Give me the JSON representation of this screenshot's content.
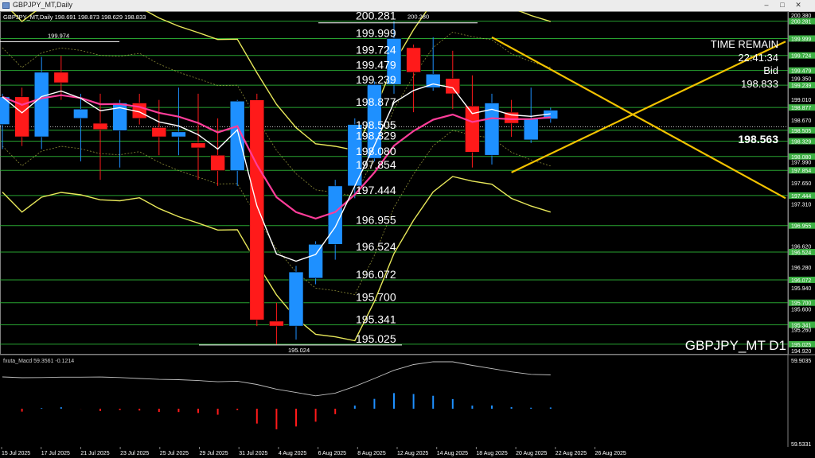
{
  "window": {
    "title": "GBPJPY_MT,Daily",
    "minimize_glyph": "–",
    "maximize_glyph": "□",
    "close_glyph": "✕"
  },
  "header": {
    "ohlc_text": "GBPJPY_MT,Daily  198.691 198.873 198.629 198.833"
  },
  "info": {
    "time_label": "TIME REMAIN",
    "time_value": "22:41:34",
    "bid_label": "Bid",
    "bid_value": "198.833",
    "current_price": "198.563",
    "symbol_label": "GBPJPY_MT D1"
  },
  "chart_data": [
    {
      "type": "candlestick",
      "title": "GBPJPY_MT,Daily",
      "ylim": [
        194.92,
        200.38
      ],
      "x_labels": [
        "15 Jul 2025",
        "17 Jul 2025",
        "21 Jul 2025",
        "23 Jul 2025",
        "25 Jul 2025",
        "29 Jul 2025",
        "31 Jul 2025",
        "4 Aug 2025",
        "6 Aug 2025",
        "8 Aug 2025",
        "12 Aug 2025",
        "14 Aug 2025",
        "18 Aug 2025",
        "20 Aug 2025",
        "22 Aug 2025",
        "26 Aug 2025"
      ],
      "axis_ticks": [
        "200.380",
        "200.281",
        "199.999",
        "199.724",
        "199.479",
        "199.350",
        "199.239",
        "199.010",
        "198.877",
        "198.670",
        "198.505",
        "198.329",
        "198.080",
        "197.990",
        "197.854",
        "197.650",
        "197.444",
        "197.310",
        "196.955",
        "196.620",
        "196.524",
        "196.280",
        "196.072",
        "195.940",
        "195.700",
        "195.600",
        "195.341",
        "195.260",
        "195.025",
        "194.920"
      ],
      "level_labels": [
        "200.281",
        "199.999",
        "199.724",
        "199.479",
        "199.239",
        "198.877",
        "198.505",
        "198.329",
        "198.080",
        "197.854",
        "197.444",
        "196.955",
        "196.524",
        "196.072",
        "195.700",
        "195.341",
        "195.025"
      ],
      "extreme_labels": [
        {
          "text": "199.974",
          "price": 199.974
        },
        {
          "text": "200.280",
          "price": 200.28
        },
        {
          "text": "195.024",
          "price": 195.024
        }
      ],
      "candles": [
        {
          "o": 198.6,
          "h": 199.1,
          "l": 198.2,
          "c": 199.05
        },
        {
          "o": 199.05,
          "h": 199.2,
          "l": 198.25,
          "c": 198.4
        },
        {
          "o": 198.4,
          "h": 199.7,
          "l": 198.2,
          "c": 199.45
        },
        {
          "o": 199.45,
          "h": 199.72,
          "l": 199.0,
          "c": 199.28
        },
        {
          "o": 198.7,
          "h": 199.1,
          "l": 198.0,
          "c": 198.85
        },
        {
          "o": 198.62,
          "h": 199.1,
          "l": 197.7,
          "c": 198.52
        },
        {
          "o": 198.5,
          "h": 199.0,
          "l": 197.9,
          "c": 198.95
        },
        {
          "o": 198.95,
          "h": 199.1,
          "l": 198.6,
          "c": 198.7
        },
        {
          "o": 198.55,
          "h": 199.0,
          "l": 198.1,
          "c": 198.4
        },
        {
          "o": 198.4,
          "h": 199.2,
          "l": 198.1,
          "c": 198.48
        },
        {
          "o": 198.3,
          "h": 199.1,
          "l": 197.7,
          "c": 198.22
        },
        {
          "o": 198.1,
          "h": 198.7,
          "l": 197.6,
          "c": 197.85
        },
        {
          "o": 197.85,
          "h": 199.0,
          "l": 197.6,
          "c": 198.98
        },
        {
          "o": 199.0,
          "h": 199.1,
          "l": 195.32,
          "c": 195.42
        },
        {
          "o": 195.4,
          "h": 195.7,
          "l": 195.02,
          "c": 195.32
        },
        {
          "o": 195.32,
          "h": 196.3,
          "l": 195.1,
          "c": 196.2
        },
        {
          "o": 196.1,
          "h": 196.7,
          "l": 196.0,
          "c": 196.65
        },
        {
          "o": 196.65,
          "h": 197.7,
          "l": 196.4,
          "c": 197.6
        },
        {
          "o": 197.6,
          "h": 198.7,
          "l": 197.4,
          "c": 198.6
        },
        {
          "o": 198.05,
          "h": 199.3,
          "l": 198.0,
          "c": 199.25
        },
        {
          "o": 199.25,
          "h": 200.28,
          "l": 199.1,
          "c": 200.0
        },
        {
          "o": 199.85,
          "h": 199.9,
          "l": 198.8,
          "c": 199.45
        },
        {
          "o": 199.2,
          "h": 200.02,
          "l": 199.15,
          "c": 199.42
        },
        {
          "o": 199.35,
          "h": 199.8,
          "l": 198.85,
          "c": 199.1
        },
        {
          "o": 198.9,
          "h": 199.4,
          "l": 197.9,
          "c": 198.15
        },
        {
          "o": 198.1,
          "h": 199.1,
          "l": 197.95,
          "c": 198.95
        },
        {
          "o": 198.8,
          "h": 199.0,
          "l": 198.4,
          "c": 198.62
        },
        {
          "o": 198.35,
          "h": 199.2,
          "l": 198.3,
          "c": 198.7
        },
        {
          "o": 198.691,
          "h": 198.873,
          "l": 198.629,
          "c": 198.833
        }
      ],
      "trendlines": [
        {
          "from": [
            25,
            200.02
          ],
          "to": [
            40,
            197.4
          ]
        },
        {
          "from": [
            26,
            197.82
          ],
          "to": [
            40,
            199.95
          ]
        }
      ]
    },
    {
      "type": "line",
      "title": "fxuta_Macd 59.3561 -0.1214",
      "ylim": [
        59.5331,
        59.9035
      ],
      "axis_ticks": [
        "59.9035",
        "59.5331"
      ]
    }
  ],
  "colors": {
    "background": "#000000",
    "bull": "#1e90ff",
    "bear": "#ff1a1a",
    "level_line": "#2fbf3a",
    "band": "#e8e85a",
    "ma_fast": "#ffffff",
    "ma_slow": "#ff3d9a",
    "trendline": "#f2c200",
    "axis_highlight": "#3cb043"
  }
}
